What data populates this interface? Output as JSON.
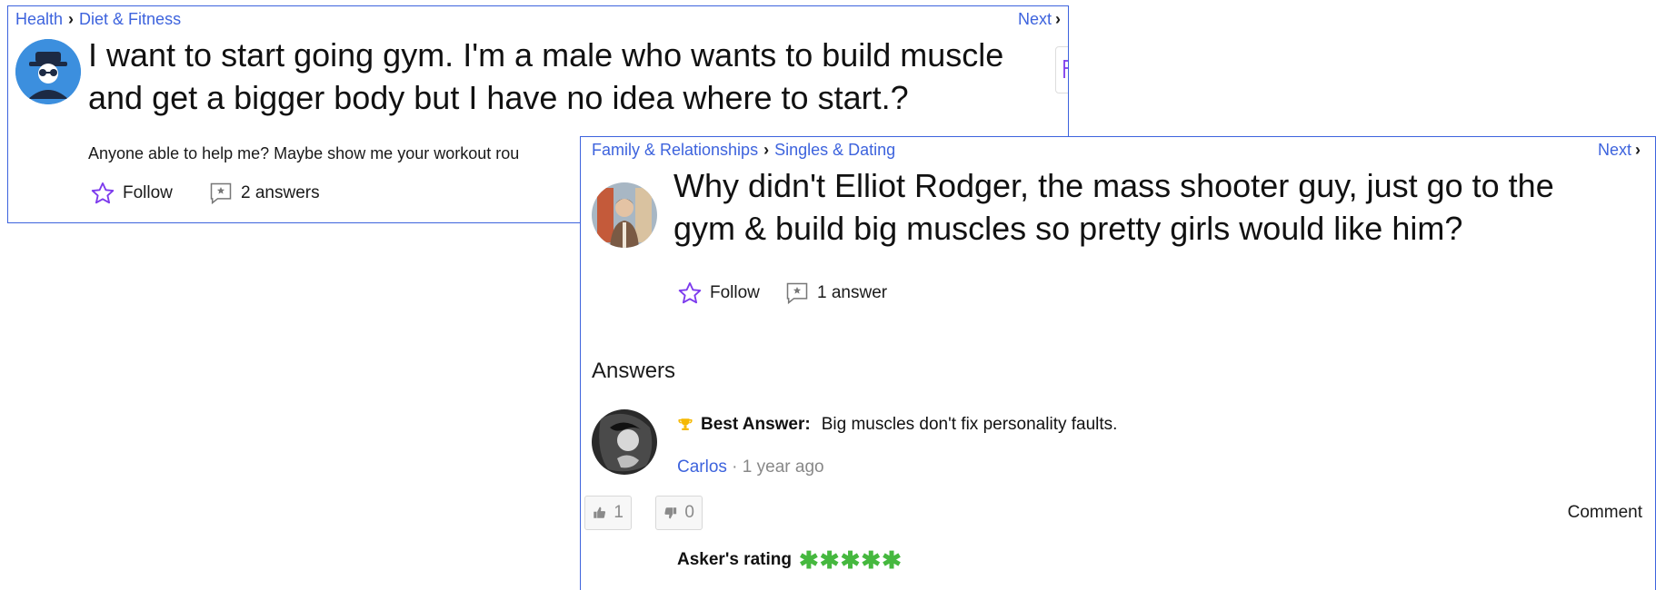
{
  "question1": {
    "breadcrumb": [
      "Health",
      "Diet & Fitness"
    ],
    "next_label": "Next",
    "title_line1": "I want to start going gym. I'm a male who wants to build muscle",
    "title_line2": "and get a bigger body but I have no idea where to start.?",
    "description": "Anyone able to help me? Maybe show me your workout rou",
    "follow_label": "Follow",
    "answers_count": "2 answers",
    "avatar_icon": "incognito-avatar-icon"
  },
  "question2": {
    "breadcrumb": [
      "Family & Relationships",
      "Singles & Dating"
    ],
    "next_label": "Next",
    "title_line1": "Why didn't Elliot Rodger, the mass shooter guy, just go to the",
    "title_line2": "gym & build big muscles so pretty girls would like him?",
    "follow_label": "Follow",
    "answers_count": "1 answer",
    "answers_heading": "Answers",
    "best_answer": {
      "label": "Best Answer:",
      "text": "Big muscles don't fix personality faults.",
      "author": "Carlos",
      "time": " · 1 year ago",
      "thumbs_up": "1",
      "thumbs_down": "0",
      "comment_label": "Comment",
      "rating_label": "Asker's rating",
      "rating_stars": 5
    }
  },
  "colors": {
    "link": "#3d63dd",
    "border": "#3d63dd",
    "follow_star": "#7c3aed",
    "rating_star": "#46b83f",
    "trophy": "#f5b800"
  }
}
